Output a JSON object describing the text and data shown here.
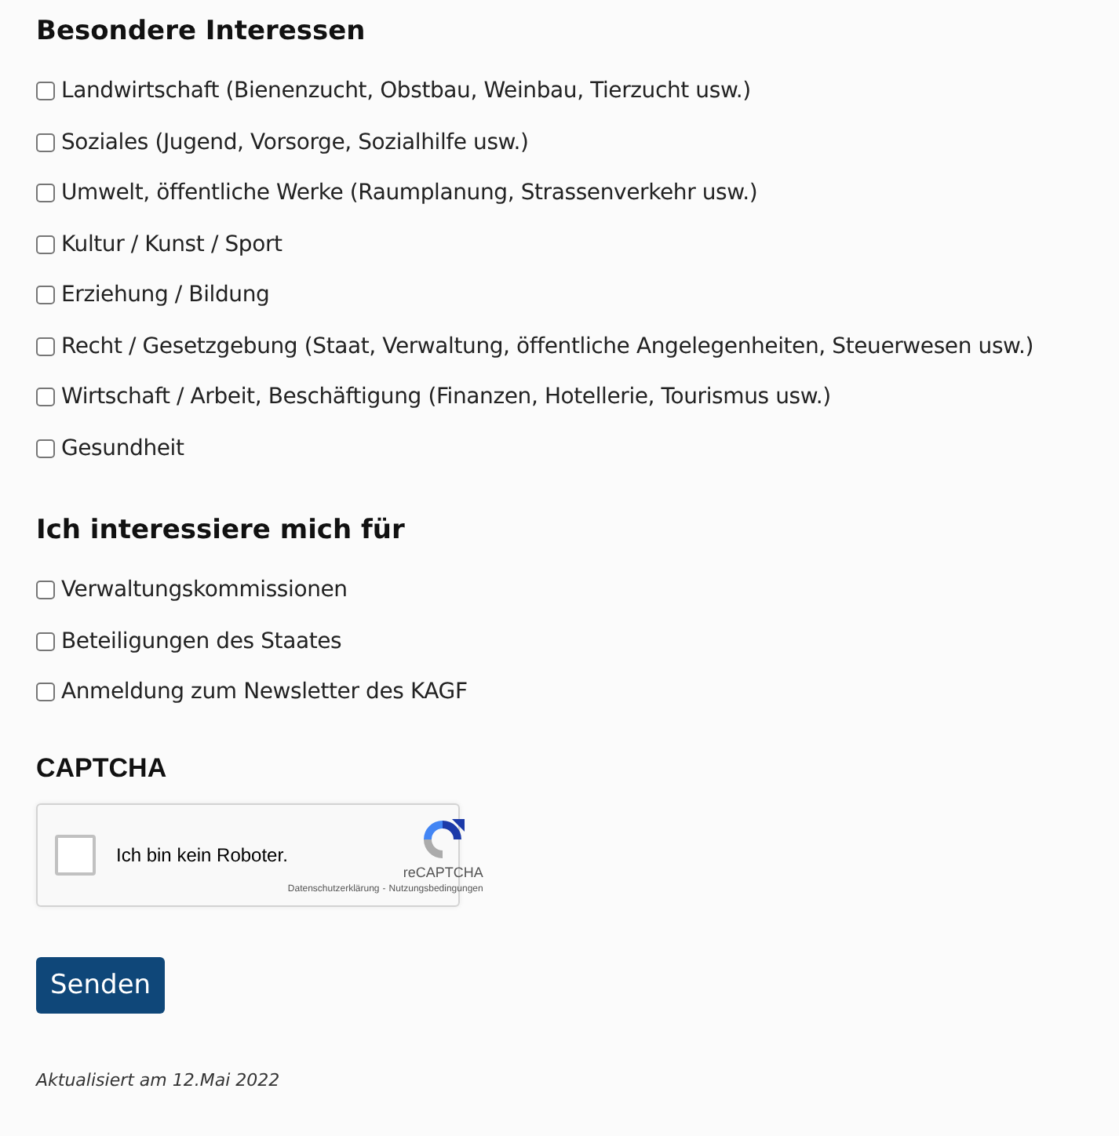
{
  "sections": [
    {
      "heading": "Besondere Interessen",
      "options": [
        {
          "label": "Landwirtschaft (Bienenzucht, Obstbau, Weinbau, Tierzucht usw.)",
          "checked": false
        },
        {
          "label": "Soziales (Jugend, Vorsorge, Sozialhilfe usw.)",
          "checked": false
        },
        {
          "label": "Umwelt, öffentliche Werke (Raumplanung, Strassenverkehr usw.)",
          "checked": false
        },
        {
          "label": "Kultur / Kunst / Sport",
          "checked": false
        },
        {
          "label": "Erziehung / Bildung",
          "checked": false
        },
        {
          "label": "Recht / Gesetzgebung (Staat, Verwaltung, öffentliche Angelegenheiten, Steuerwesen usw.)",
          "checked": false
        },
        {
          "label": "Wirtschaft / Arbeit, Beschäftigung (Finanzen, Hotellerie, Tourismus usw.)",
          "checked": false
        },
        {
          "label": "Gesundheit",
          "checked": false
        }
      ]
    },
    {
      "heading": "Ich interessiere mich für",
      "options": [
        {
          "label": "Verwaltungskommissionen",
          "checked": false
        },
        {
          "label": "Beteiligungen des Staates",
          "checked": false
        },
        {
          "label": "Anmeldung zum Newsletter des KAGF",
          "checked": false
        }
      ]
    }
  ],
  "captcha": {
    "heading": "CAPTCHA",
    "label": "Ich bin kein Roboter.",
    "checked": false,
    "brand": "reCAPTCHA",
    "privacy": "Datenschutzerklärung",
    "separator": "-",
    "terms": "Nutzungsbedingungen"
  },
  "submit": "Senden",
  "updated": "Aktualisiert am 12.Mai 2022"
}
